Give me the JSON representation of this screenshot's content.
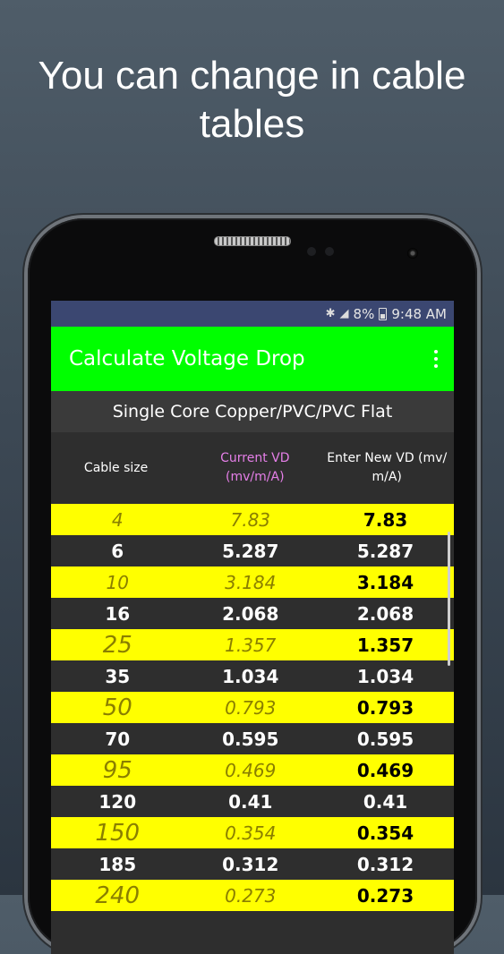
{
  "promo": {
    "line1": "You can change in cable",
    "line2": "tables"
  },
  "status_bar": {
    "bluetooth_icon": "bluetooth-icon",
    "signal_icon": "signal-icon",
    "battery": "8%",
    "time": "9:48 AM"
  },
  "app_bar": {
    "title": "Calculate Voltage Drop",
    "menu_icon": "overflow-menu-icon"
  },
  "table": {
    "title": "Single Core Copper/PVC/PVC Flat",
    "headers": {
      "size": "Cable size",
      "current": "Current VD (mv/m/A)",
      "new": "Enter New VD (mv/ m/A)"
    },
    "rows": [
      {
        "size": "4",
        "current": "7.83",
        "new": "7.83"
      },
      {
        "size": "6",
        "current": "5.287",
        "new": "5.287"
      },
      {
        "size": "10",
        "current": "3.184",
        "new": "3.184"
      },
      {
        "size": "16",
        "current": "2.068",
        "new": "2.068"
      },
      {
        "size": "25",
        "current": "1.357",
        "new": "1.357"
      },
      {
        "size": "35",
        "current": "1.034",
        "new": "1.034"
      },
      {
        "size": "50",
        "current": "0.793",
        "new": "0.793"
      },
      {
        "size": "70",
        "current": "0.595",
        "new": "0.595"
      },
      {
        "size": "95",
        "current": "0.469",
        "new": "0.469"
      },
      {
        "size": "120",
        "current": "0.41",
        "new": "0.41"
      },
      {
        "size": "150",
        "current": "0.354",
        "new": "0.354"
      },
      {
        "size": "185",
        "current": "0.312",
        "new": "0.312"
      },
      {
        "size": "240",
        "current": "0.273",
        "new": "0.273"
      }
    ]
  },
  "colors": {
    "app_bar": "#00ff00",
    "status_bar": "#3b4771",
    "row_highlight": "#ffff00",
    "row_dark": "#2e2e2e",
    "header_accent": "#e57fe8"
  }
}
